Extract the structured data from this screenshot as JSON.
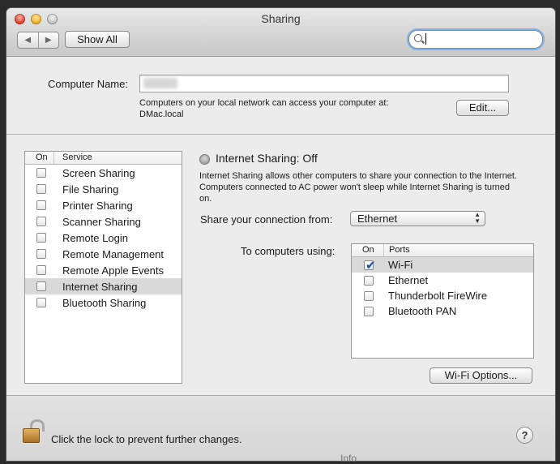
{
  "window": {
    "title": "Sharing"
  },
  "toolbar": {
    "show_all_label": "Show All",
    "search_value": ""
  },
  "computer_name": {
    "label": "Computer Name:",
    "value": "DMac",
    "access_text": "Computers on your local network can access your computer at:",
    "local_address": "DMac.local",
    "edit_label": "Edit..."
  },
  "services": {
    "col_on": "On",
    "col_service": "Service",
    "items": [
      {
        "label": "Screen Sharing",
        "on": false,
        "selected": false
      },
      {
        "label": "File Sharing",
        "on": false,
        "selected": false
      },
      {
        "label": "Printer Sharing",
        "on": false,
        "selected": false
      },
      {
        "label": "Scanner Sharing",
        "on": false,
        "selected": false
      },
      {
        "label": "Remote Login",
        "on": false,
        "selected": false
      },
      {
        "label": "Remote Management",
        "on": false,
        "selected": false
      },
      {
        "label": "Remote Apple Events",
        "on": false,
        "selected": false
      },
      {
        "label": "Internet Sharing",
        "on": false,
        "selected": true
      },
      {
        "label": "Bluetooth Sharing",
        "on": false,
        "selected": false
      }
    ]
  },
  "internet_sharing": {
    "status": "Internet Sharing: Off",
    "description": "Internet Sharing allows other computers to share your connection to the Internet. Computers connected to AC power won't sleep while Internet Sharing is turned on.",
    "share_from_label": "Share your connection from:",
    "share_from_value": "Ethernet",
    "to_computers_label": "To computers using:",
    "ports_col_on": "On",
    "ports_col_ports": "Ports",
    "ports": [
      {
        "label": "Wi-Fi",
        "on": true,
        "selected": true
      },
      {
        "label": "Ethernet",
        "on": false,
        "selected": false
      },
      {
        "label": "Thunderbolt FireWire",
        "on": false,
        "selected": false
      },
      {
        "label": "Bluetooth PAN",
        "on": false,
        "selected": false
      }
    ],
    "wifi_options_label": "Wi-Fi Options..."
  },
  "footer": {
    "lock_text": "Click the lock to prevent further changes.",
    "help_label": "?"
  },
  "background_peek": "Info"
}
